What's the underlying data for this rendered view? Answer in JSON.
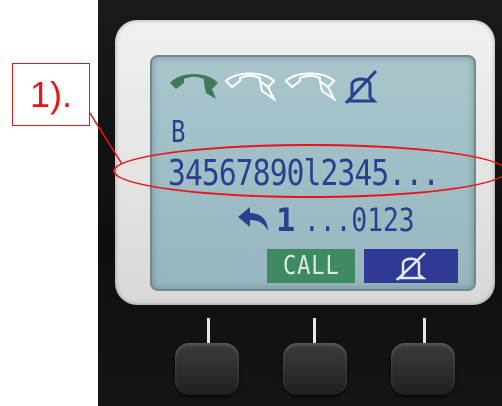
{
  "annotation": {
    "label": "1).",
    "color": "#e8141a"
  },
  "display": {
    "status_icons": [
      "handset-active-icon",
      "handset-idle-icon",
      "handset-idle-icon",
      "ringer-muted-icon"
    ],
    "line_label": "B",
    "dialed_number": "34567890l2345...",
    "redial_count": "1",
    "redial_number": "...0123"
  },
  "softkeys": {
    "call_label": "CALL",
    "mute_icon": "bell-muted-icon"
  },
  "colors": {
    "lcd": "#a9c6cd",
    "text": "#2a3f8d",
    "call_key": "#3f8a63",
    "mute_key": "#2e3a94",
    "active_handset": "#3e7a55"
  }
}
